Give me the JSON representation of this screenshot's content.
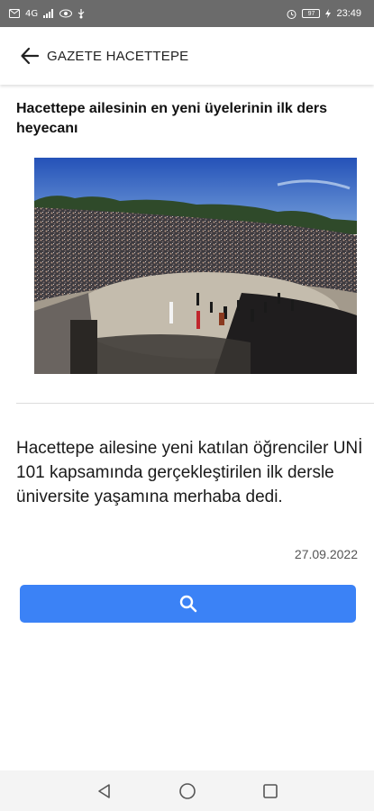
{
  "status_bar": {
    "network": "4G",
    "battery": "97",
    "time": "23:49"
  },
  "app_bar": {
    "title": "GAZETE HACETTEPE",
    "back_icon": "arrow-left-icon"
  },
  "article": {
    "headline": "Hacettepe ailesinin en yeni üyelerinin ilk ders heyecanı",
    "body": "Hacettepe ailesine yeni katılan öğrenciler UNİ 101 kapsamında gerçekleştirilen ilk dersle üniversite yaşamına merhaba dedi.",
    "date": "27.09.2022"
  },
  "search_button": {
    "icon": "search-icon",
    "color": "#3b82f6"
  },
  "nav_bar": {
    "back_icon": "triangle-back-icon",
    "home_icon": "circle-home-icon",
    "recents_icon": "square-recents-icon"
  }
}
